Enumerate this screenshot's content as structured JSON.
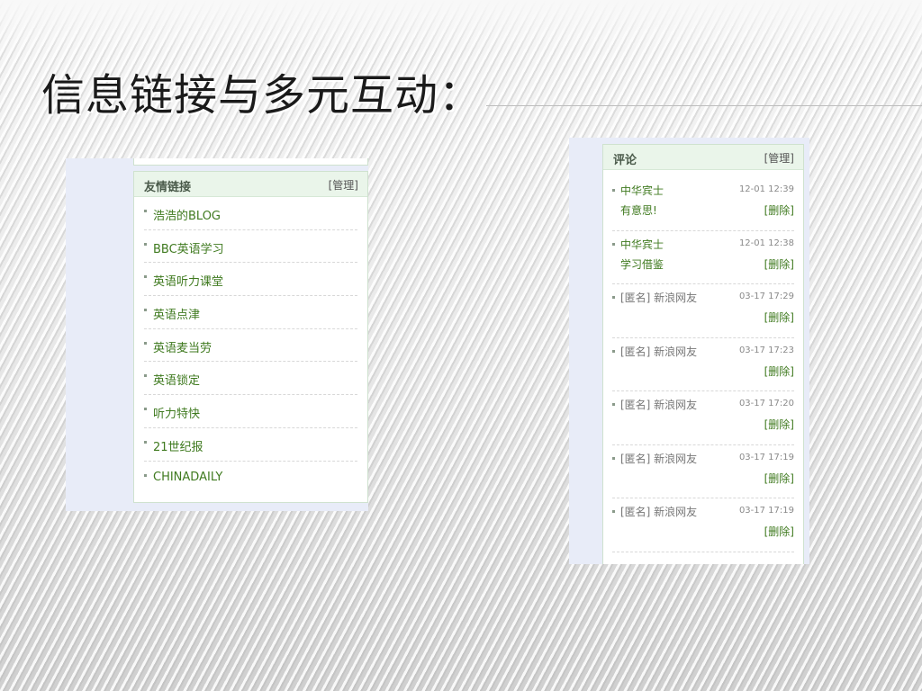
{
  "slide": {
    "title": "信息链接与多元互动："
  },
  "links_widget": {
    "title": "友情链接",
    "manage_label": "[管理]",
    "items": [
      {
        "label": "浩浩的BLOG"
      },
      {
        "label": "BBC英语学习"
      },
      {
        "label": "英语听力课堂"
      },
      {
        "label": "英语点津"
      },
      {
        "label": "英语麦当劳"
      },
      {
        "label": "英语锁定"
      },
      {
        "label": "听力特快"
      },
      {
        "label": "21世纪报"
      },
      {
        "label": "CHINADAILY"
      }
    ]
  },
  "comments_widget": {
    "title": "评论",
    "manage_label": "[管理]",
    "delete_label": "[删除]",
    "items": [
      {
        "author": "中华宾士",
        "time": "12-01 12:39",
        "text": "有意思!",
        "anonymous": false
      },
      {
        "author": "中华宾士",
        "time": "12-01 12:38",
        "text": "学习借鉴",
        "anonymous": false
      },
      {
        "author": "[匿名] 新浪网友",
        "time": "03-17 17:29",
        "text": "",
        "anonymous": true
      },
      {
        "author": "[匿名] 新浪网友",
        "time": "03-17 17:23",
        "text": "",
        "anonymous": true
      },
      {
        "author": "[匿名] 新浪网友",
        "time": "03-17 17:20",
        "text": "",
        "anonymous": true
      },
      {
        "author": "[匿名] 新浪网友",
        "time": "03-17 17:19",
        "text": "",
        "anonymous": true
      },
      {
        "author": "[匿名] 新浪网友",
        "time": "03-17 17:19",
        "text": "",
        "anonymous": true
      }
    ]
  },
  "colors": {
    "link_green": "#3f7a1f",
    "header_bg": "#eaf5ea",
    "panel_bg": "#e8ecf8"
  }
}
